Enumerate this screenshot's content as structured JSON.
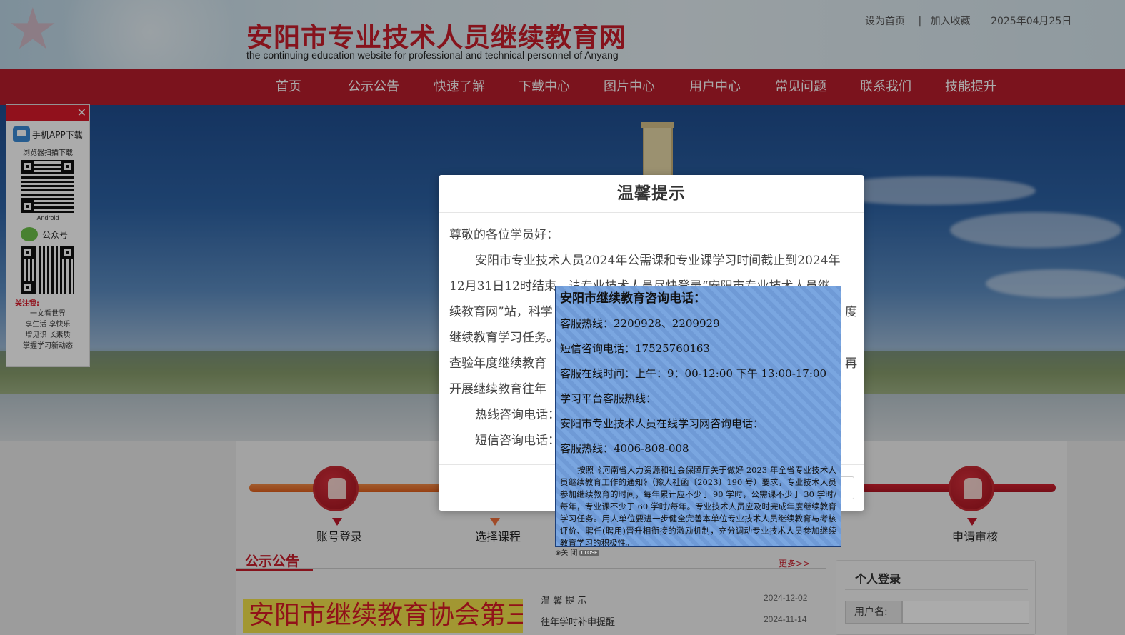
{
  "header": {
    "title": "安阳市专业技术人员继续教育网",
    "subtitle": "the continuing education website for professional and technical personnel of Anyang",
    "set_home": "设为首页",
    "sep": "|",
    "add_favorite": "加入收藏",
    "date": "2025年04月25日"
  },
  "nav": {
    "items": [
      "首页",
      "公示公告",
      "快速了解",
      "下载中心",
      "图片中心",
      "用户中心",
      "常见问题",
      "联系我们",
      "技能提升"
    ]
  },
  "qr_panel": {
    "close": "✕",
    "app_download": "手机APP下载",
    "scan_hint": "浏览器扫描下载",
    "android": "Android",
    "wechat": "公众号",
    "follow": "关注我:",
    "lines": [
      "一文看世界",
      "享生活  享快乐",
      "增见识  长素质",
      "掌握学习新动态"
    ]
  },
  "steps": {
    "login": "账号登录",
    "choose_course": "选择课程",
    "apply_review": "申请审核"
  },
  "notices": {
    "title": "公示公告",
    "more": "更多>>",
    "marquee": "安阳市继续教育协会第三",
    "items": [
      {
        "title": "温 馨 提 示",
        "date": "2024-12-02"
      },
      {
        "title": "往年学时补申提醒",
        "date": "2024-11-14"
      }
    ]
  },
  "login": {
    "title": "个人登录",
    "username_label": "用户名:"
  },
  "modal": {
    "title": "温馨提示",
    "greeting": "尊敬的各位学员好：",
    "p1_line1": "安阳市专业技术人员2024年公需课和专业课学习时间截止到2024年",
    "p1_line2": "12月31日12时结束，请专业技术人员尽快登录“安阳市专业技术人员继",
    "p1_line3": "续教育网”站，科学",
    "p1_line3b": "度",
    "p1_line4": "继续教育学习任务。",
    "p1_line5": "查验年度继续教育",
    "p1_line5b": "再",
    "p1_line6": "开展继续教育往年",
    "hotline": "热线咨询电话：",
    "sms": "短信咨询电话："
  },
  "consult": {
    "head": "安阳市继续教育咨询电话：",
    "rows": [
      "客服热线：2209928、2209929",
      "短信咨询电话：17525760163",
      "客服在线时间：上午：9：00-12:00 下午 13:00-17:00",
      "学习平台客服热线：",
      "安阳市专业技术人员在线学习网咨询电话：",
      "客服热线：4006-808-008"
    ],
    "notice": "按照《河南省人力资源和社会保障厅关于做好 2023 年全省专业技术人员继续教育工作的通知》（豫人社函〔2023〕190 号）要求，专业技术人员参加继续教育的时间，每年累计应不少于 90 学时，公需课不少于 30 学时/每年，专业课不少于 60 学时/每年。专业技术人员应及时完成年度继续教育学习任务。用人单位要进一步健全完善本单位专业技术人员继续教育与考核评价、聘任(聘用)晋升相衔接的激励机制，充分调动专业技术人员参加继续教育学习的积极性。",
    "close_text": "⊗关 闭",
    "close_tag": "CLOSE"
  }
}
